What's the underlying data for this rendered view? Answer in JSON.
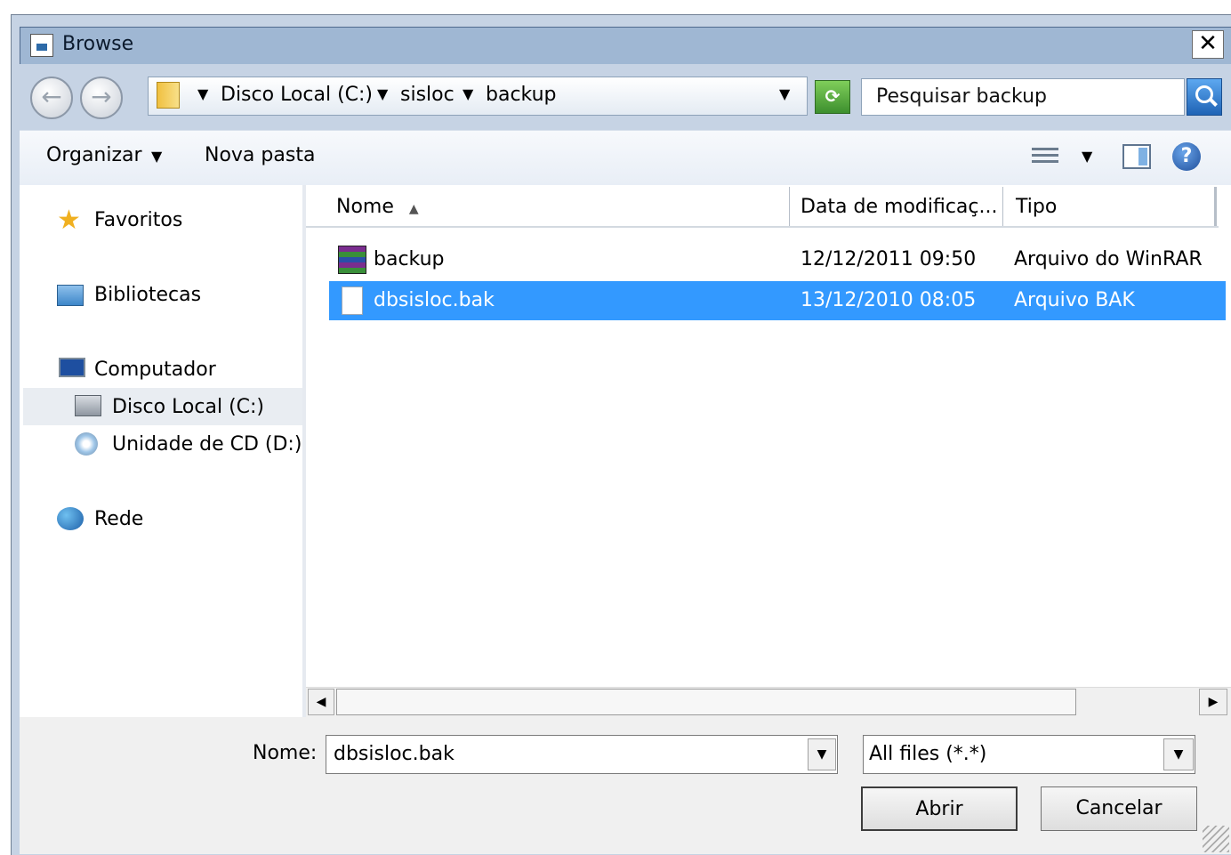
{
  "window": {
    "title": "Browse",
    "close_label": "✕"
  },
  "address": {
    "crumbs": [
      "Disco Local (C:)",
      "sisloc",
      "backup"
    ],
    "search_placeholder": "Pesquisar backup"
  },
  "toolbar": {
    "organize_label": "Organizar",
    "new_folder_label": "Nova pasta"
  },
  "nav": {
    "favorites": "Favoritos",
    "libraries": "Bibliotecas",
    "computer": "Computador",
    "local_disk": "Disco Local (C:)",
    "cd_drive": "Unidade de CD (D:)",
    "network": "Rede"
  },
  "columns": {
    "name": "Nome",
    "modified": "Data de modificaç...",
    "type": "Tipo"
  },
  "files": [
    {
      "name": "backup",
      "modified": "12/12/2011 09:50",
      "type": "Arquivo do WinRAR",
      "icon": "winrar-archive-icon",
      "selected": false
    },
    {
      "name": "dbsisloc.bak",
      "modified": "13/12/2010 08:05",
      "type": "Arquivo BAK",
      "icon": "blank-file-icon",
      "selected": true
    }
  ],
  "form": {
    "name_label": "Nome:",
    "name_value": "dbsisloc.bak",
    "filter_value": "All files (*.*)",
    "open_label": "Abrir",
    "cancel_label": "Cancelar"
  },
  "colors": {
    "selection": "#3399ff",
    "frame": "#c6d3e4",
    "titlebar": "#9fb7d3"
  }
}
